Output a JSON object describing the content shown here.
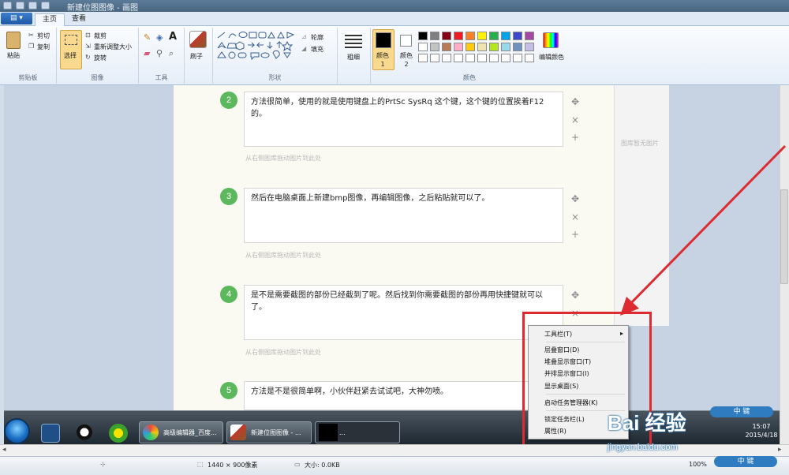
{
  "titlebar": {
    "title": "新建位图图像 - 画图"
  },
  "tabs": {
    "file": "▤ ▾",
    "home": "主页",
    "view": "查看"
  },
  "ribbon": {
    "clipboard": {
      "paste": "粘贴",
      "cut": "剪切",
      "copy": "复制",
      "label": "剪贴板"
    },
    "image": {
      "select": "选择",
      "crop": "裁剪",
      "resize": "重新调整大小",
      "rotate": "旋转",
      "label": "图像"
    },
    "tools": {
      "label": "工具"
    },
    "brushes": {
      "label": "刷子"
    },
    "shapes": {
      "outline": "轮廓",
      "fill": "填充",
      "label": "形状"
    },
    "size": {
      "label": "粗细"
    },
    "colors": {
      "color1": "颜色 1",
      "color2": "颜色 2",
      "edit": "编辑颜色",
      "label": "颜色",
      "palette": [
        "#000000",
        "#7f7f7f",
        "#880015",
        "#ed1c24",
        "#ff7f27",
        "#fff200",
        "#22b14c",
        "#00a2e8",
        "#3f48cc",
        "#a349a4",
        "#ffffff",
        "#c3c3c3",
        "#b97a57",
        "#ffaec9",
        "#ffc90e",
        "#efe4b0",
        "#b5e61d",
        "#99d9ea",
        "#7092be",
        "#c8bfe7",
        "#ffffff",
        "#ffffff",
        "#ffffff",
        "#ffffff",
        "#ffffff",
        "#ffffff",
        "#ffffff",
        "#ffffff",
        "#ffffff",
        "#ffffff"
      ]
    }
  },
  "steps": [
    {
      "num": "2",
      "text": "方法很简单，使用的就是使用键盘上的PrtSc SysRq 这个键，这个键的位置挨着F12的。",
      "drag": "从右侧图库拖动图片到此处"
    },
    {
      "num": "3",
      "text": "然后在电脑桌面上新建bmp图像，再编辑图像，之后粘贴就可以了。",
      "drag": "从右侧图库拖动图片到此处"
    },
    {
      "num": "4",
      "text": "是不是需要截图的部份已经截到了呢。然后找到你需要截图的部份再用快捷键就可以了。",
      "drag": "从右侧图库拖动图片到此处"
    },
    {
      "num": "5",
      "text": "方法是不是很简单啊，小伙伴赶紧去试试吧，大神勿喷。"
    }
  ],
  "side_icons": {
    "move": "✥",
    "close": "×",
    "add": "+"
  },
  "right_panel": {
    "empty": "图库暂无图片"
  },
  "taskbar": {
    "tasks": [
      "高级编辑器_百度...",
      "新建位图图像 - ...",
      "..."
    ],
    "time": "15:07",
    "date": "2015/4/18"
  },
  "context_menu": [
    {
      "label": "工具栏(T)",
      "arrow": "▸"
    },
    {
      "label": "层叠窗口(D)"
    },
    {
      "label": "堆叠显示窗口(T)"
    },
    {
      "label": "并排显示窗口(I)"
    },
    {
      "label": "显示桌面(S)"
    },
    {
      "label": "启动任务管理器(K)"
    },
    {
      "label": "锁定任务栏(L)"
    },
    {
      "label": "属性(R)"
    }
  ],
  "statusbar": {
    "dimensions": "1440 × 900像素",
    "size": "大小: 0.0KB",
    "zoom": "100%"
  },
  "watermark": {
    "brand": "Bai 经验",
    "url": "jingyan.baidu.com",
    "ime": "中 键"
  }
}
